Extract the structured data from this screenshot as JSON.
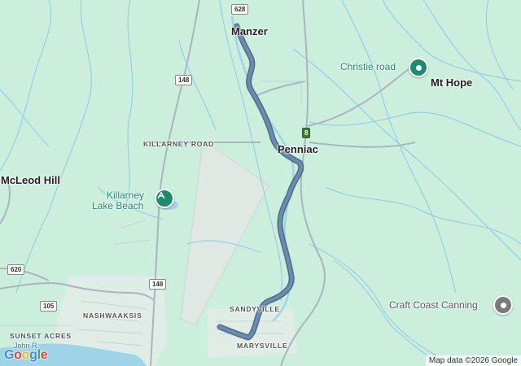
{
  "map": {
    "towns": [
      {
        "id": "manzer",
        "label": "Manzer"
      },
      {
        "id": "penniac",
        "label": "Penniac"
      },
      {
        "id": "mt-hope",
        "label": "Mt Hope"
      },
      {
        "id": "mcleod-hill",
        "label": "McLeod Hill"
      }
    ],
    "areas": [
      {
        "id": "killarney-road",
        "label": "KILLARNEY ROAD"
      },
      {
        "id": "nashwaaksis",
        "label": "NASHWAAKSIS"
      },
      {
        "id": "sunset-acres",
        "label": "SUNSET ACRES"
      },
      {
        "id": "sandyville",
        "label": "SANDYVILLE"
      },
      {
        "id": "marysville",
        "label": "MARYSVILLE"
      }
    ],
    "pois": [
      {
        "id": "christie-road",
        "label": "Christie road",
        "icon": "location-pin-icon",
        "color": "#1e8a6e"
      },
      {
        "id": "killarney-lake-beach",
        "label_line1": "Killarney",
        "label_line2": "Lake Beach",
        "icon": "picnic-pin-icon",
        "color": "#1e8a6e"
      },
      {
        "id": "craft-coast-canning",
        "label": "Craft Coast Canning",
        "icon": "location-pin-icon",
        "color": "#7a7a7a"
      }
    ],
    "road_shields": [
      {
        "id": "628",
        "label": "628"
      },
      {
        "id": "148-north",
        "label": "148"
      },
      {
        "id": "148-south",
        "label": "148"
      },
      {
        "id": "620",
        "label": "620"
      },
      {
        "id": "105",
        "label": "105"
      },
      {
        "id": "8",
        "label": "8"
      }
    ],
    "water_label": "John R",
    "route_color": "#5a7a98",
    "water_color": "#9fd4e8",
    "land_color": "#cbeedd"
  },
  "branding": {
    "logo": "Google",
    "attribution": "Map data ©2026 Google"
  }
}
